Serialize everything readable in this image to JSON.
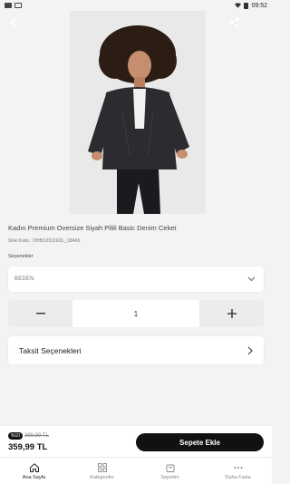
{
  "status_bar": {
    "time": "09:52"
  },
  "product": {
    "title": "Kadın Premium Oversize Siyah Pilili Basic Denim Ceket",
    "sku": "Stok Kodu : DHBO25316DL_18A66",
    "options_label": "Seçenekler",
    "size_select_value": "BEDEN",
    "quantity": "1",
    "installments_label": "Taksit Seçenekleri"
  },
  "pricing": {
    "discount_badge": "%10",
    "old_price": "399,99 TL",
    "price": "359,99 TL",
    "add_to_cart_label": "Sepete Ekle"
  },
  "tabs": [
    {
      "label": "Ana Sayfa",
      "icon": "home-icon",
      "active": true
    },
    {
      "label": "Kategoriler",
      "icon": "grid-icon",
      "active": false
    },
    {
      "label": "Sepetim",
      "icon": "cart-icon",
      "active": false
    },
    {
      "label": "Daha Fazla",
      "icon": "more-icon",
      "active": false
    }
  ],
  "colors": {
    "accent": "#111111",
    "background": "#f3f3f3"
  }
}
